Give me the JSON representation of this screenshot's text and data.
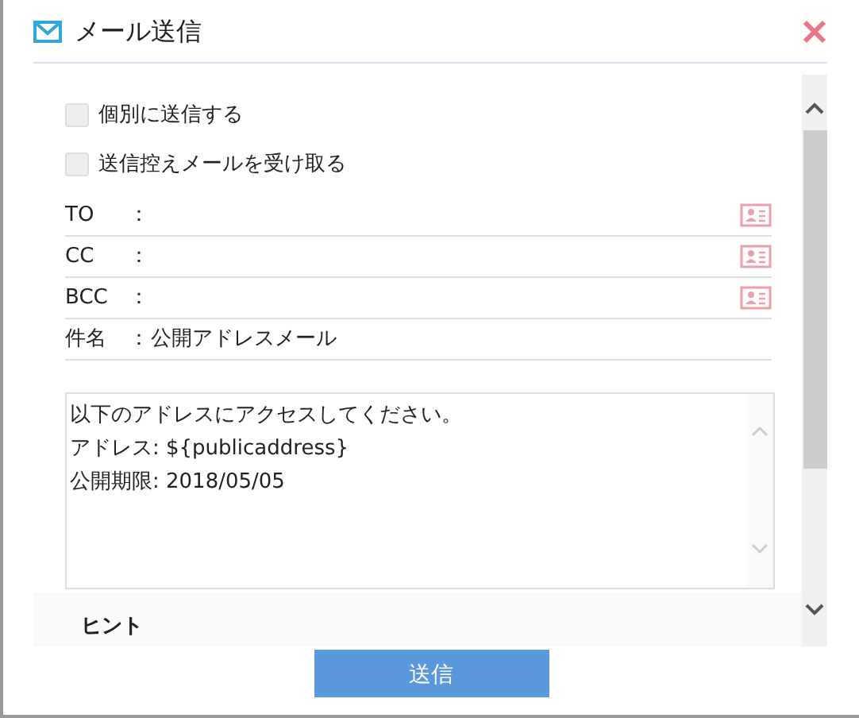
{
  "window": {
    "title": "メール送信"
  },
  "options": [
    {
      "label": "個別に送信する",
      "checked": false
    },
    {
      "label": "送信控えメールを受け取る",
      "checked": false
    }
  ],
  "fields": [
    {
      "label": "TO",
      "separator": "：",
      "address_book": true
    },
    {
      "label": "CC",
      "separator": "：",
      "address_book": true
    },
    {
      "label": "BCC",
      "separator": "：",
      "address_book": true
    },
    {
      "label": "件名",
      "separator": "：",
      "value": "公開アドレスメール",
      "address_book": false
    }
  ],
  "message": {
    "lines": [
      "以下のアドレスにアクセスしてください。",
      "アドレス: ${publicaddress}",
      "公開期限: 2018/05/05"
    ]
  },
  "hint": {
    "title": "ヒント"
  },
  "send_button": "送信"
}
